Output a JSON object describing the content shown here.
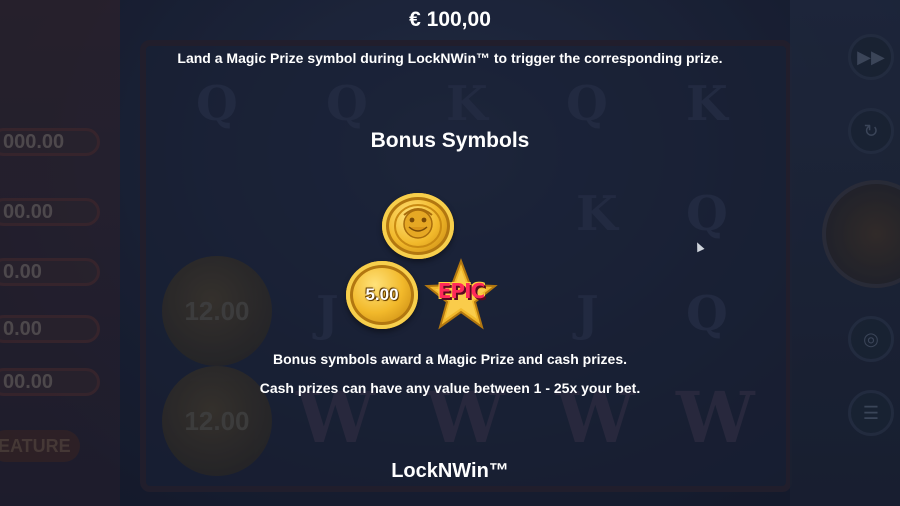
{
  "info": {
    "amount": "€ 100,00",
    "trigger_description": "Land a Magic Prize symbol during LockNWin™ to trigger the corresponding prize.",
    "section_title": "Bonus Symbols",
    "coin_value": "5.00",
    "epic_label": "EPIC",
    "bonus_description": "Bonus symbols award a Magic Prize and cash prizes.",
    "cash_description": "Cash prizes can have any value between 1 - 25x your bet.",
    "next_section_title": "LockNWin™"
  },
  "background": {
    "prize_values": [
      "000.00",
      "00.00",
      "0.00",
      "0.00",
      "00.00"
    ],
    "feature_label": "EATURE",
    "reel_coin_values": [
      "12.00",
      "12.00"
    ],
    "reel_letters": [
      "Q",
      "Q",
      "K",
      "Q",
      "K",
      "K",
      "Q",
      "J",
      "J",
      "Q"
    ]
  },
  "colors": {
    "text": "#ffffff",
    "coin_gold": "#f2b92b",
    "epic_red": "#ff2a5a",
    "background": "#1a2036"
  },
  "icons": {
    "right_buttons": [
      "fast-forward-icon",
      "autoplay-icon",
      "spin-icon",
      "bet-icon",
      "menu-icon"
    ]
  }
}
